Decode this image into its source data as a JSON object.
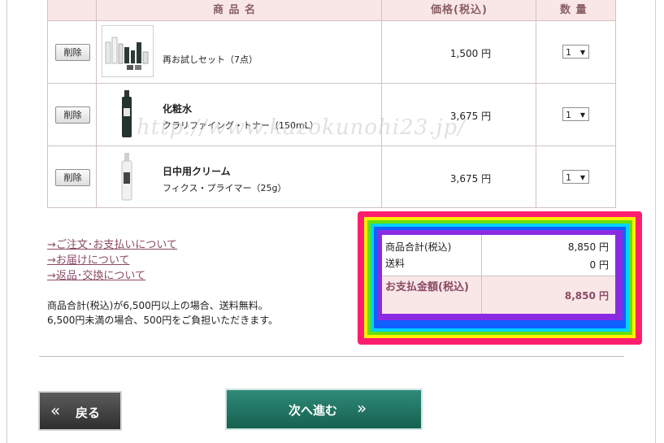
{
  "cart": {
    "headers": {
      "name": "商 品 名",
      "price": "価格(税込)",
      "qty": "数 量"
    },
    "delete_label": "削除",
    "items": [
      {
        "name_bold": "",
        "name": "再お試しセット（7点）",
        "price": "1,500 円",
        "qty": "1",
        "thumb_icon": "product-set-image"
      },
      {
        "name_bold": "化粧水",
        "name": "クラリファイング・トナー（150mL）",
        "price": "3,675 円",
        "qty": "1",
        "thumb_icon": "toner-bottle-image"
      },
      {
        "name_bold": "日中用クリーム",
        "name": "フィクス・プライマー（25g）",
        "price": "3,675 円",
        "qty": "1",
        "thumb_icon": "cream-bottle-image"
      }
    ],
    "qty_arrow": "▼"
  },
  "watermark": "http://www.kazokunohi23.jp/",
  "links": {
    "order_payment": "→ご注文･お支払いについて",
    "delivery": "→お届けについて",
    "returns": "→返品･交換について"
  },
  "notes": {
    "line1": "商品合計(税込)が6,500円以上の場合、送料無料。",
    "line2": "6,500円未満の場合、500円をご負担いただきます。"
  },
  "summary": {
    "subtotal_label": "商品合計(税込)",
    "subtotal_value": "8,850 円",
    "shipping_label": "送料",
    "shipping_value": "0 円",
    "total_label": "お支払金額(税込)",
    "total_value": "8,850 円"
  },
  "buttons": {
    "back": "戻る",
    "back_icon": "«",
    "next": "次へ進む",
    "next_icon": "»"
  },
  "colors": {
    "accent": "#8a4a64",
    "header_bg": "#f9e7e7",
    "next_button": "#1f7563",
    "rainbow": [
      "#ff1f6e",
      "#ffef00",
      "#66e000",
      "#00d3ff",
      "#1060ff",
      "#8a2be2"
    ]
  }
}
